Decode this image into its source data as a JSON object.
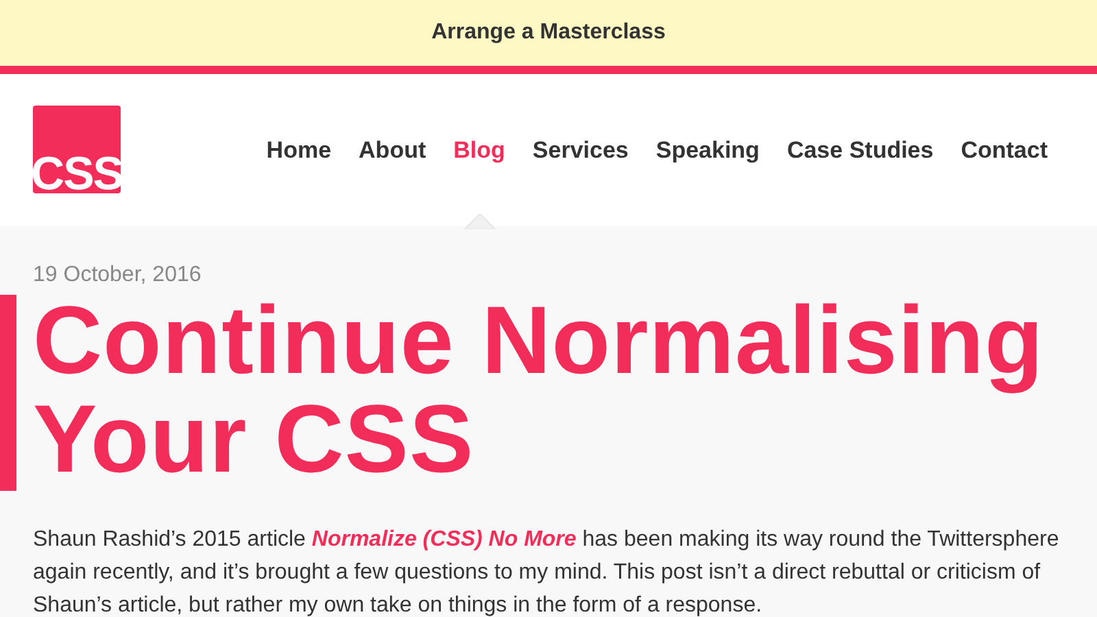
{
  "banner": {
    "link": "Arrange a Masterclass"
  },
  "logo": {
    "text": "CSS"
  },
  "nav": [
    {
      "label": "Home",
      "selected": false
    },
    {
      "label": "About",
      "selected": false
    },
    {
      "label": "Blog",
      "selected": true
    },
    {
      "label": "Services",
      "selected": false
    },
    {
      "label": "Speaking",
      "selected": false
    },
    {
      "label": "Case Studies",
      "selected": false
    },
    {
      "label": "Contact",
      "selected": false
    }
  ],
  "post": {
    "date": "19 October, 2016",
    "title": "Continue Normalising Your CSS",
    "intro": {
      "before": "Shaun Rashid’s 2015 article ",
      "link": "Normalize (CSS) No More",
      "after": " has been making its way round the Twittersphere again recently, and it’s brought a few questions to my mind. This post isn’t a direct rebuttal or criticism of Shaun’s article, but rather my own take on things in the form of a response."
    }
  }
}
